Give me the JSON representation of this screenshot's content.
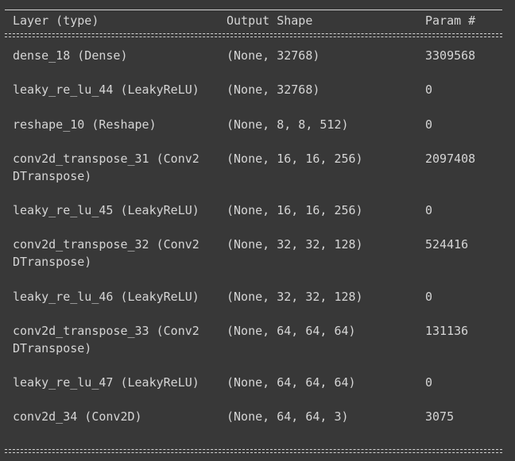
{
  "header": {
    "layer": "Layer (type)",
    "shape": "Output Shape",
    "param": "Param #"
  },
  "rows": [
    {
      "layer": "dense_18 (Dense)",
      "shape": "(None, 32768)",
      "param": "3309568"
    },
    {
      "layer": "leaky_re_lu_44 (LeakyReLU)",
      "shape": "(None, 32768)",
      "param": "0"
    },
    {
      "layer": "reshape_10 (Reshape)",
      "shape": "(None, 8, 8, 512)",
      "param": "0"
    },
    {
      "layer": "conv2d_transpose_31 (Conv2\nDTranspose)",
      "shape": "(None, 16, 16, 256)",
      "param": "2097408"
    },
    {
      "layer": "leaky_re_lu_45 (LeakyReLU)",
      "shape": "(None, 16, 16, 256)",
      "param": "0"
    },
    {
      "layer": "conv2d_transpose_32 (Conv2\nDTranspose)",
      "shape": "(None, 32, 32, 128)",
      "param": "524416"
    },
    {
      "layer": "leaky_re_lu_46 (LeakyReLU)",
      "shape": "(None, 32, 32, 128)",
      "param": "0"
    },
    {
      "layer": "conv2d_transpose_33 (Conv2\nDTranspose)",
      "shape": "(None, 64, 64, 64)",
      "param": "131136"
    },
    {
      "layer": "leaky_re_lu_47 (LeakyReLU)",
      "shape": "(None, 64, 64, 64)",
      "param": "0"
    },
    {
      "layer": "conv2d_34 (Conv2D)",
      "shape": "(None, 64, 64, 3)",
      "param": "3075"
    }
  ]
}
